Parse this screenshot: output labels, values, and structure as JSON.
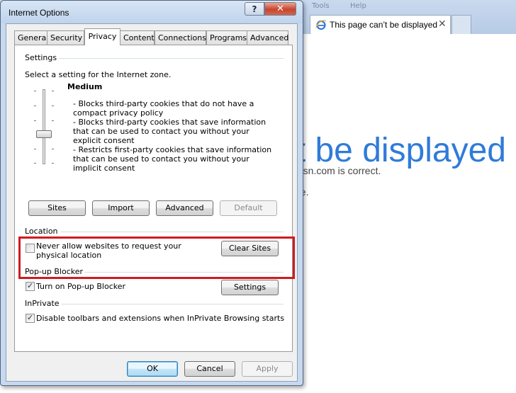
{
  "browser": {
    "menu": [
      "Tools",
      "Help"
    ],
    "tab_title": "This page can’t be displayed",
    "tab_close": "✕",
    "heading_fragment": "t be displayed",
    "line1_fragment": "msn.com is correct.",
    "line2_fragment": "ne."
  },
  "dialog": {
    "title": "Internet Options",
    "help_glyph": "?",
    "close_glyph": "✕",
    "tabs": [
      "General",
      "Security",
      "Privacy",
      "Content",
      "Connections",
      "Programs",
      "Advanced"
    ],
    "active_tab": "Privacy"
  },
  "settings": {
    "header": "Settings",
    "zone_text": "Select a setting for the Internet zone.",
    "level": "Medium",
    "description": [
      "- Blocks third-party cookies that do not have a compact privacy policy",
      "- Blocks third-party cookies that save information that can be used to contact you without your explicit consent",
      "- Restricts first-party cookies that save information that can be used to contact you without your implicit consent"
    ],
    "buttons": {
      "sites": "Sites",
      "import": "Import",
      "advanced": "Advanced",
      "default": "Default"
    }
  },
  "location": {
    "header": "Location",
    "checkbox_label": "Never allow websites to request your physical location",
    "checked": false,
    "clear_sites": "Clear Sites"
  },
  "popup": {
    "header": "Pop-up Blocker",
    "checkbox_label": "Turn on Pop-up Blocker",
    "checked": true,
    "settings": "Settings"
  },
  "inprivate": {
    "header": "InPrivate",
    "checkbox_label": "Disable toolbars and extensions when InPrivate Browsing starts",
    "checked": true
  },
  "footer": {
    "ok": "OK",
    "cancel": "Cancel",
    "apply": "Apply"
  },
  "colors": {
    "highlight": "#d11a1f",
    "ie_blue": "#2f7bd8"
  }
}
